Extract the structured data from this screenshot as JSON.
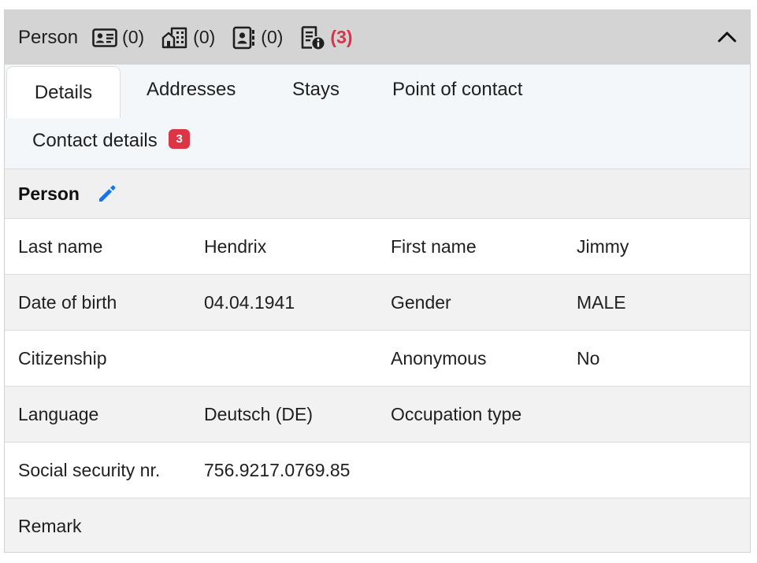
{
  "header": {
    "title": "Person",
    "stats": [
      {
        "icon": "id-card-icon",
        "count": "(0)"
      },
      {
        "icon": "buildings-icon",
        "count": "(0)"
      },
      {
        "icon": "contact-book-icon",
        "count": "(0)"
      },
      {
        "icon": "document-info-icon",
        "count": "(3)"
      }
    ]
  },
  "tabs": {
    "details": "Details",
    "addresses": "Addresses",
    "stays": "Stays",
    "point_of_contact": "Point of contact",
    "contact_details": "Contact details",
    "contact_details_badge": "3"
  },
  "section": {
    "title": "Person"
  },
  "rows": [
    {
      "label1": "Last name",
      "value1": "Hendrix",
      "label2": "First name",
      "value2": "Jimmy"
    },
    {
      "label1": "Date of birth",
      "value1": "04.04.1941",
      "label2": "Gender",
      "value2": "MALE"
    },
    {
      "label1": "Citizenship",
      "value1": "",
      "label2": "Anonymous",
      "value2": "No"
    },
    {
      "label1": "Language",
      "value1": "Deutsch (DE)",
      "label2": "Occupation type",
      "value2": ""
    },
    {
      "label1": "Social security nr.",
      "value1": "756.9217.0769.85",
      "label2": "",
      "value2": ""
    },
    {
      "label1": "Remark",
      "value1": "",
      "label2": "",
      "value2": ""
    }
  ],
  "colors": {
    "accent": "#1a73e8",
    "badge": "#dc3545",
    "alert_text": "#d63447",
    "header_bg": "#d4d4d4"
  }
}
